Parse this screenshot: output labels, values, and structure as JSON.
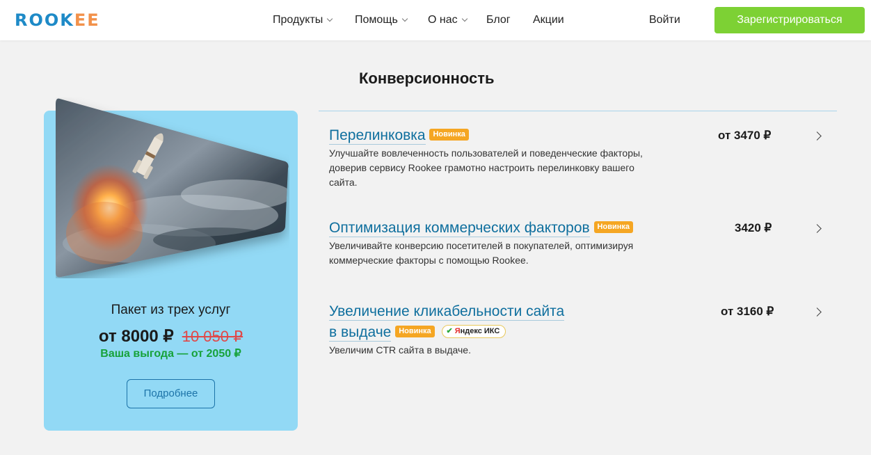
{
  "header": {
    "logo_part_a": "ROOK",
    "logo_part_b": "EE",
    "nav": [
      {
        "label": "Продукты",
        "has_dropdown": true
      },
      {
        "label": "Помощь",
        "has_dropdown": true
      },
      {
        "label": "О нас",
        "has_dropdown": true
      },
      {
        "label": "Блог",
        "has_dropdown": false
      },
      {
        "label": "Акции",
        "has_dropdown": false
      }
    ],
    "login_label": "Войти",
    "register_label": "Зарегистрироваться"
  },
  "section": {
    "title": "Конверсионность"
  },
  "promo": {
    "title": "Пакет из трех услуг",
    "price": "от 8000 ₽",
    "old_price": "10 050 ₽",
    "benefit": "Ваша выгода — от 2050 ₽",
    "button_label": "Подробнее"
  },
  "services": [
    {
      "title": "Перелинковка",
      "badge": "Новинка",
      "description_lines": [
        "Улучшайте вовлеченность пользователей и поведенческие факторы,",
        "доверив сервису Rookee грамотно настроить перелинковку вашего",
        "сайта."
      ],
      "price": "от 3470 ₽"
    },
    {
      "title": "Оптимизация коммерческих факторов",
      "badge": "Новинка",
      "description_lines": [
        "Увеличивайте конверсию посетителей в покупателей, оптимизируя",
        "коммерческие факторы с помощью Rookee."
      ],
      "price": "3420 ₽"
    },
    {
      "title_line1": "Увеличение кликабельности сайта",
      "title_line2": "в выдаче",
      "badge": "Новинка",
      "extra_badge_ya": "Я",
      "extra_badge_rest": "ндекс ИКС",
      "description_lines": [
        "Увеличим CTR сайта в выдаче."
      ],
      "price": "от 3160 ₽"
    }
  ],
  "colors": {
    "accent_blue": "#0f6f9e",
    "register_green": "#7dd134",
    "badge_orange": "#f5a623",
    "promo_bg": "#92d9f5",
    "benefit_green": "#17a23a",
    "old_price_red": "#e04848"
  },
  "icons": [
    "chevron-down-icon",
    "chevron-right-icon",
    "check-icon"
  ]
}
